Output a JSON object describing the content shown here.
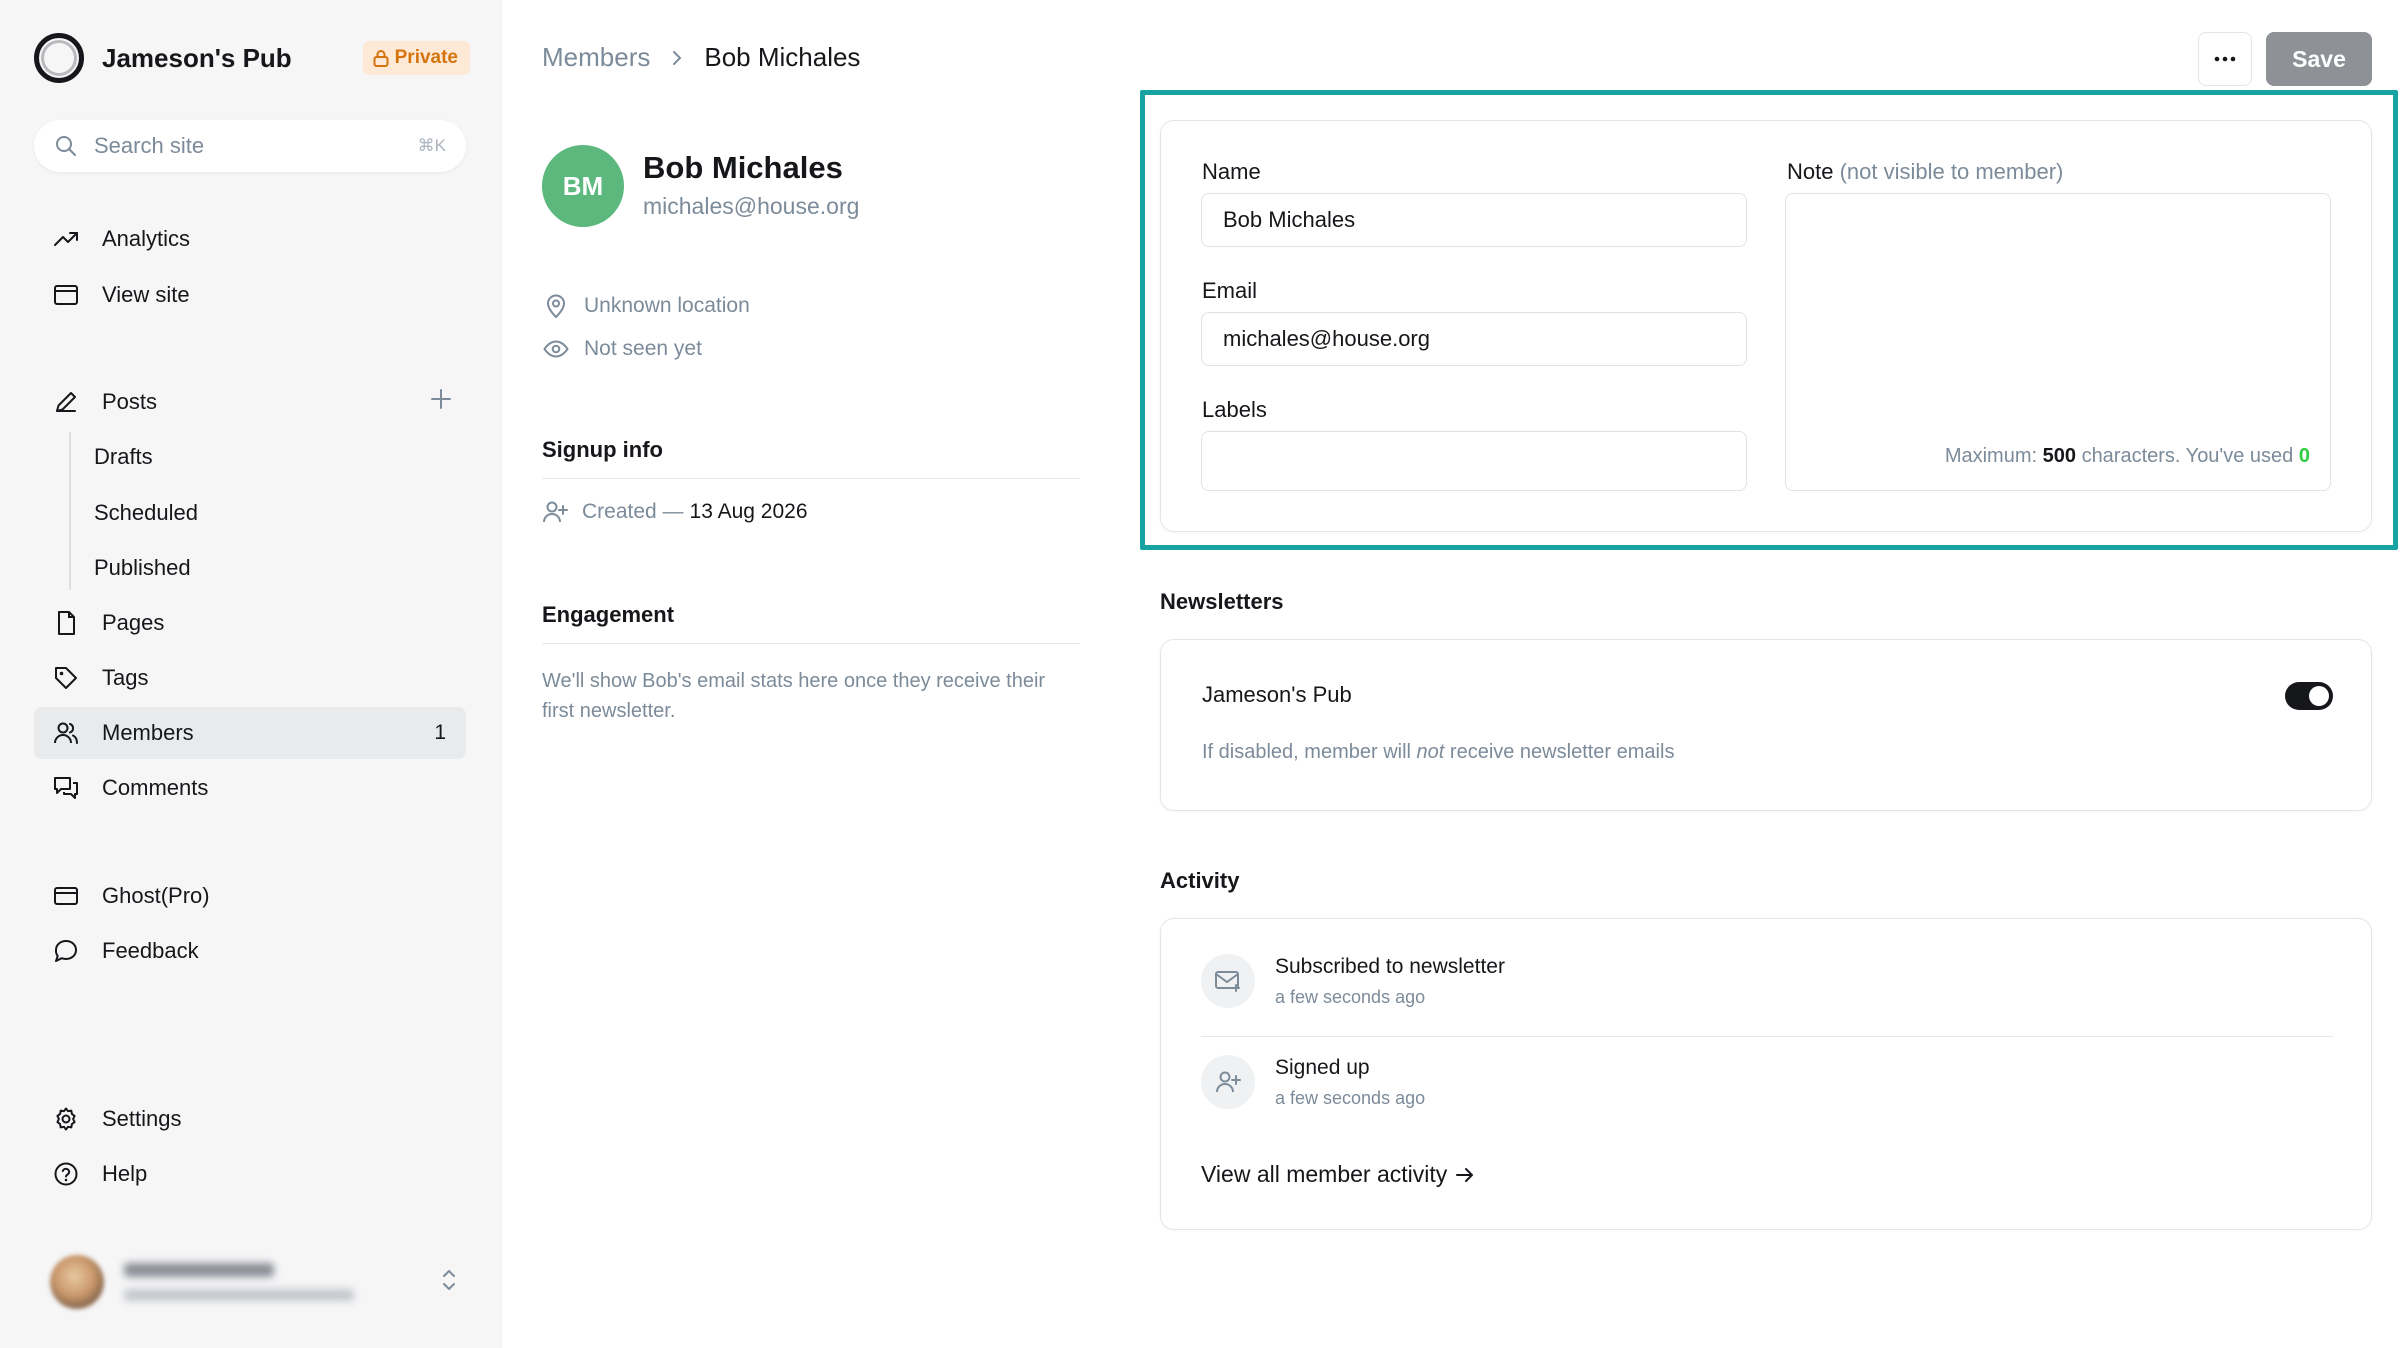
{
  "sidebar": {
    "brand": "Jameson's Pub",
    "private_badge": "Private",
    "search_placeholder": "Search site",
    "search_shortcut": "⌘K",
    "items": {
      "analytics": "Analytics",
      "view_site": "View site",
      "posts": "Posts",
      "drafts": "Drafts",
      "scheduled": "Scheduled",
      "published": "Published",
      "pages": "Pages",
      "tags": "Tags",
      "members": "Members",
      "members_count": "1",
      "comments": "Comments",
      "ghost_pro": "Ghost(Pro)",
      "feedback": "Feedback",
      "settings": "Settings",
      "help": "Help"
    }
  },
  "header": {
    "breadcrumb_parent": "Members",
    "breadcrumb_current": "Bob Michales",
    "save_label": "Save"
  },
  "member": {
    "initials": "BM",
    "name": "Bob Michales",
    "email": "michales@house.org",
    "location": "Unknown location",
    "seen": "Not seen yet",
    "signup_title": "Signup info",
    "created_label": "Created —",
    "created_date": "13 Aug 2026",
    "engagement_title": "Engagement",
    "engagement_text": "We'll show Bob's email stats here once they receive their first newsletter."
  },
  "form": {
    "name_label": "Name",
    "name_value": "Bob Michales",
    "email_label": "Email",
    "email_value": "michales@house.org",
    "labels_label": "Labels",
    "labels_value": "",
    "note_label": "Note",
    "note_hint": "(not visible to member)",
    "note_value": "",
    "note_max_prefix": "Maximum:",
    "note_max_value": "500",
    "note_max_suffix": "characters. You've used",
    "note_used": "0"
  },
  "newsletters": {
    "title": "Newsletters",
    "name": "Jameson's Pub",
    "desc_pre": "If disabled, member will",
    "desc_em": "not",
    "desc_post": "receive newsletter emails",
    "subscribed": true
  },
  "activity": {
    "title": "Activity",
    "items": [
      {
        "text": "Subscribed to newsletter",
        "time": "a few seconds ago",
        "icon": "mail-plus-icon"
      },
      {
        "text": "Signed up",
        "time": "a few seconds ago",
        "icon": "user-plus-icon"
      }
    ],
    "view_all": "View all member activity"
  },
  "colors": {
    "highlight": "#17a3a3",
    "avatar": "#5cb87c",
    "private_bg": "#fde9d6",
    "private_fg": "#d5740f",
    "save_bg": "#8e9196"
  }
}
